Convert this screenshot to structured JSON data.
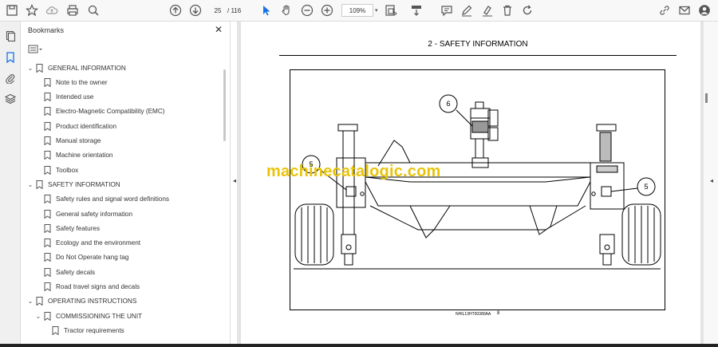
{
  "toolbar": {
    "page_current": "25",
    "page_total": "/  116",
    "zoom": "109%"
  },
  "panel": {
    "title": "Bookmarks",
    "close_label": "✕"
  },
  "bookmarks": [
    {
      "label": "GENERAL INFORMATION",
      "level": 0,
      "expanded": true
    },
    {
      "label": "Note to the owner",
      "level": 1
    },
    {
      "label": "Intended use",
      "level": 1
    },
    {
      "label": "Electro-Magnetic Compatibility (EMC)",
      "level": 1
    },
    {
      "label": "Product identification",
      "level": 1
    },
    {
      "label": "Manual storage",
      "level": 1
    },
    {
      "label": "Machine orientation",
      "level": 1
    },
    {
      "label": "Toolbox",
      "level": 1
    },
    {
      "label": "SAFETY INFORMATION",
      "level": 0,
      "expanded": true
    },
    {
      "label": "Safety rules and signal word definitions",
      "level": 1
    },
    {
      "label": "General safety information",
      "level": 1
    },
    {
      "label": "Safety features",
      "level": 1
    },
    {
      "label": "Ecology and the environment",
      "level": 1
    },
    {
      "label": "Do Not Operate hang tag",
      "level": 1
    },
    {
      "label": "Safety decals",
      "level": 1
    },
    {
      "label": "Road travel signs and decals",
      "level": 1
    },
    {
      "label": "OPERATING INSTRUCTIONS",
      "level": 0,
      "expanded": true
    },
    {
      "label": "COMMISSIONING THE UNIT",
      "level": 1,
      "expanded": true
    },
    {
      "label": "Tractor requirements",
      "level": 2
    }
  ],
  "document": {
    "heading": "2 - SAFETY INFORMATION",
    "figure_code": "NHIL13HT00380AA",
    "figure_number": "8",
    "callouts": [
      "6",
      "5",
      "5"
    ],
    "watermark": "machinecatalogic.com"
  }
}
